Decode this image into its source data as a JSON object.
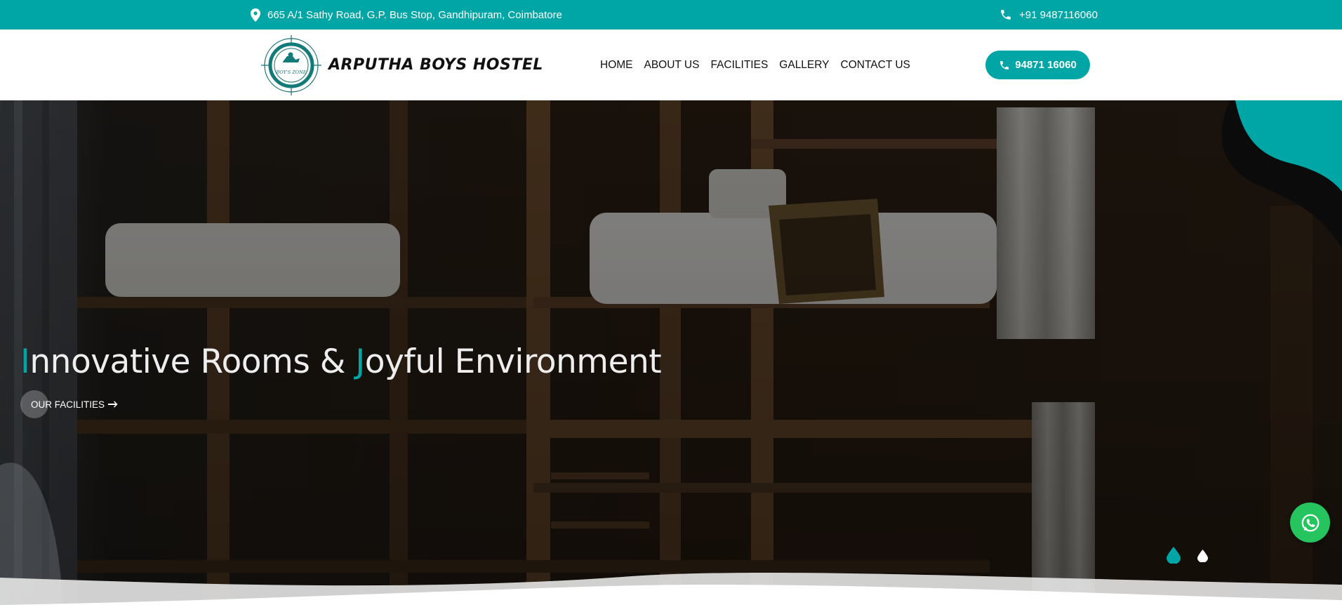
{
  "topbar": {
    "address_icon": "map-pin-icon",
    "address": "665 A/1 Sathy Road, G.P. Bus Stop, Gandhipuram, Coimbatore",
    "phone_icon": "phone-icon",
    "phone": "+91 9487116060"
  },
  "header": {
    "logo_icon": "hostel-logo-emblem",
    "logo_text": "BOY'S ZONE",
    "brand": "ARPUTHA BOYS HOSTEL",
    "nav": [
      "HOME",
      "ABOUT US",
      "FACILITIES",
      "GALLERY",
      "CONTACT US"
    ],
    "call_button": "94871 16060"
  },
  "hero": {
    "title_first_letter": "I",
    "title_part1": "nnovative Rooms & ",
    "title_second_letter": "J",
    "title_part2": "oyful Environment",
    "button_label": "OUR FACILITIES",
    "slider_dots": 2,
    "active_slide": 1
  },
  "colors": {
    "accent": "#00a6a6",
    "whatsapp": "#25c45e",
    "text_dark": "#111111"
  },
  "floating": {
    "whatsapp_icon": "whatsapp-icon"
  }
}
